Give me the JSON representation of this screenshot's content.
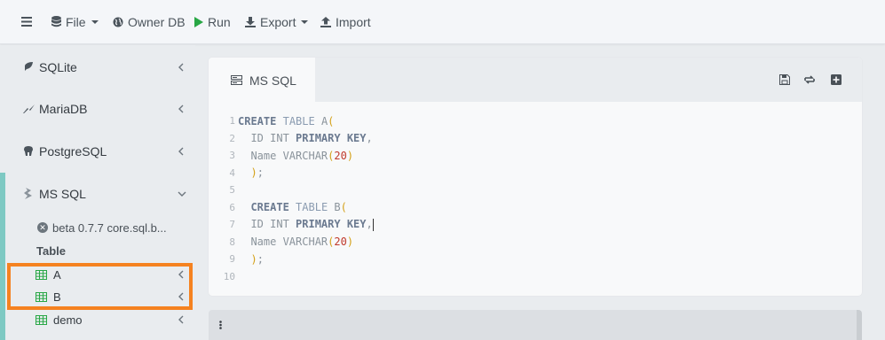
{
  "navbar": {
    "menu_icon": "hamburger-icon",
    "file_label": "File",
    "owner_db_label": "Owner DB",
    "run_label": "Run",
    "export_label": "Export",
    "import_label": "Import"
  },
  "sidebar": {
    "databases": [
      {
        "label": "SQLite",
        "icon": "feather-icon"
      },
      {
        "label": "MariaDB",
        "icon": "mariadb-icon"
      },
      {
        "label": "PostgreSQL",
        "icon": "elephant-icon"
      },
      {
        "label": "MS SQL",
        "icon": "mssql-icon"
      }
    ],
    "connection_label": "beta 0.7.7 core.sql.b...",
    "table_header": "Table",
    "tables": [
      {
        "label": "A"
      },
      {
        "label": "B"
      },
      {
        "label": "demo"
      }
    ]
  },
  "editor_card": {
    "tab_label": "MS SQL",
    "line_numbers": [
      "1",
      "2",
      "3",
      "4",
      "5",
      "6",
      "7",
      "8",
      "9",
      "10"
    ]
  },
  "colors": {
    "accent_bar": "#7ec9c3",
    "highlight": "#f58220",
    "run_icon": "#28a745",
    "table_icon": "#28a745"
  }
}
